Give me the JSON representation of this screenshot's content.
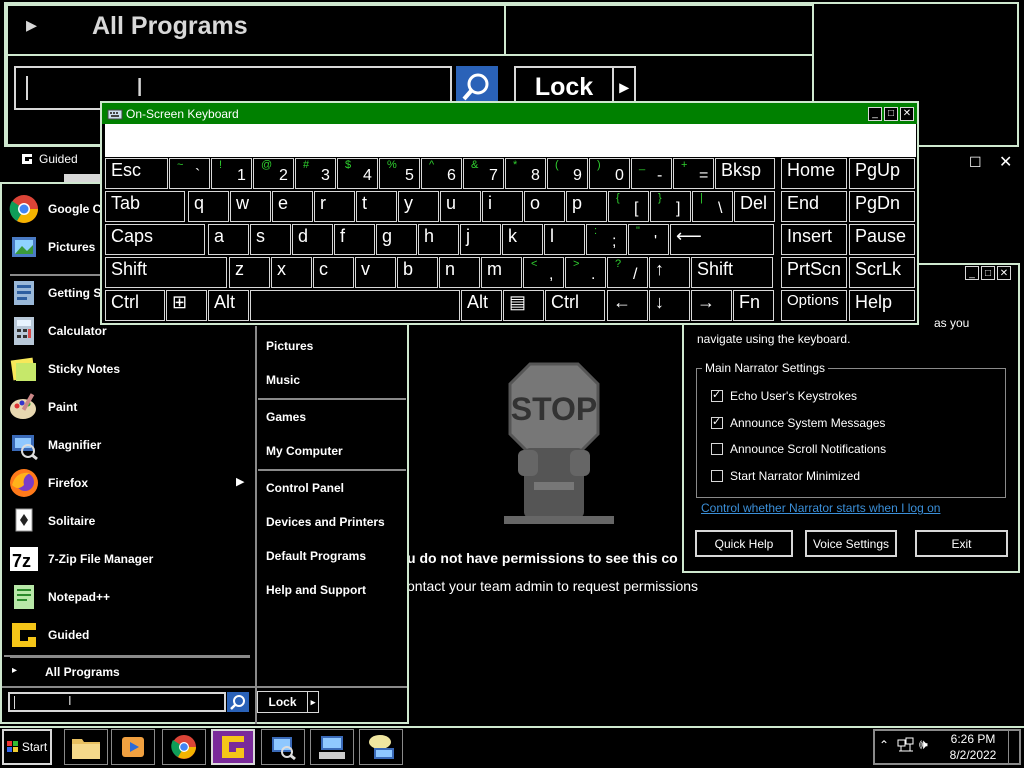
{
  "magnifier": {
    "all_programs": "All Programs",
    "lock": "Lock"
  },
  "guided": {
    "title": "Guided",
    "no_permission": "u do not have permissions to see this co",
    "contact_admin": "ontact your team admin to request permissions",
    "stop_sign": "STOP"
  },
  "keyboard": {
    "title": "On-Screen Keyboard",
    "rows": [
      [
        {
          "main": "Esc"
        },
        {
          "sub": "~",
          "base": "`"
        },
        {
          "sub": "!",
          "base": "1"
        },
        {
          "sub": "@",
          "base": "2"
        },
        {
          "sub": "#",
          "base": "3"
        },
        {
          "sub": "$",
          "base": "4"
        },
        {
          "sub": "%",
          "base": "5"
        },
        {
          "sub": "^",
          "base": "6"
        },
        {
          "sub": "&",
          "base": "7"
        },
        {
          "sub": "*",
          "base": "8"
        },
        {
          "sub": "(",
          "base": "9"
        },
        {
          "sub": ")",
          "base": "0"
        },
        {
          "sub": "_",
          "base": "-"
        },
        {
          "sub": "+",
          "base": "="
        },
        {
          "main": "Bksp"
        },
        {
          "main": "Home"
        },
        {
          "main": "PgUp"
        }
      ],
      [
        {
          "main": "Tab"
        },
        {
          "main": "q"
        },
        {
          "main": "w"
        },
        {
          "main": "e"
        },
        {
          "main": "r"
        },
        {
          "main": "t"
        },
        {
          "main": "y"
        },
        {
          "main": "u"
        },
        {
          "main": "i"
        },
        {
          "main": "o"
        },
        {
          "main": "p"
        },
        {
          "sub": "{",
          "base": "["
        },
        {
          "sub": "}",
          "base": "]"
        },
        {
          "sub": "|",
          "base": "\\"
        },
        {
          "main": "Del"
        },
        {
          "main": "End"
        },
        {
          "main": "PgDn"
        }
      ],
      [
        {
          "main": "Caps"
        },
        {
          "main": "a"
        },
        {
          "main": "s"
        },
        {
          "main": "d"
        },
        {
          "main": "f"
        },
        {
          "main": "g"
        },
        {
          "main": "h"
        },
        {
          "main": "j"
        },
        {
          "main": "k"
        },
        {
          "main": "l"
        },
        {
          "sub": ":",
          "base": ";"
        },
        {
          "sub": "\"",
          "base": "'"
        },
        {
          "main": "⟵"
        },
        {
          "main": "Insert"
        },
        {
          "main": "Pause"
        }
      ],
      [
        {
          "main": "Shift"
        },
        {
          "main": "z"
        },
        {
          "main": "x"
        },
        {
          "main": "c"
        },
        {
          "main": "v"
        },
        {
          "main": "b"
        },
        {
          "main": "n"
        },
        {
          "main": "m"
        },
        {
          "sub": "<",
          "base": ","
        },
        {
          "sub": ">",
          "base": "."
        },
        {
          "sub": "?",
          "base": "/"
        },
        {
          "main": "↑"
        },
        {
          "main": "Shift"
        },
        {
          "main": "PrtScn"
        },
        {
          "main": "ScrLk"
        }
      ],
      [
        {
          "main": "Ctrl"
        },
        {
          "main": "⊞"
        },
        {
          "main": "Alt"
        },
        {
          "main": ""
        },
        {
          "main": "Alt"
        },
        {
          "main": "▤"
        },
        {
          "main": "Ctrl"
        },
        {
          "main": "←"
        },
        {
          "main": "↓"
        },
        {
          "main": "→"
        },
        {
          "main": "Fn"
        },
        {
          "main": "Options"
        },
        {
          "main": "Help"
        }
      ]
    ]
  },
  "start_menu": {
    "programs": [
      {
        "label": "Google C",
        "icon": "chrome-icon"
      },
      {
        "label": "Pictures",
        "icon": "pictures-icon"
      },
      {
        "label": "Getting S",
        "icon": "getting-started-icon"
      },
      {
        "label": "Calculator",
        "icon": "calculator-icon"
      },
      {
        "label": "Sticky Notes",
        "icon": "sticky-notes-icon"
      },
      {
        "label": "Paint",
        "icon": "paint-icon"
      },
      {
        "label": "Magnifier",
        "icon": "magnifier-icon"
      },
      {
        "label": "Firefox",
        "icon": "firefox-icon"
      },
      {
        "label": "Solitaire",
        "icon": "solitaire-icon"
      },
      {
        "label": "7-Zip File Manager",
        "icon": "7zip-icon"
      },
      {
        "label": "Notepad++",
        "icon": "notepadpp-icon"
      },
      {
        "label": "Guided",
        "icon": "guided-icon"
      }
    ],
    "all_programs": "All Programs",
    "right_links": [
      "Pictures",
      "Music",
      "Games",
      "My Computer",
      "Control Panel",
      "Devices and Printers",
      "Default Programs",
      "Help and Support"
    ],
    "lock": "Lock"
  },
  "narrator": {
    "intro_tail": "as you",
    "intro_line2": "navigate using the keyboard.",
    "group_title": "Main Narrator Settings",
    "options": [
      {
        "label": "Echo User's Keystrokes",
        "checked": true
      },
      {
        "label": "Announce System Messages",
        "checked": true
      },
      {
        "label": "Announce Scroll Notifications",
        "checked": false
      },
      {
        "label": "Start Narrator Minimized",
        "checked": false
      }
    ],
    "link": "Control whether Narrator starts when I log on",
    "buttons": [
      "Quick Help",
      "Voice Settings",
      "Exit"
    ]
  },
  "taskbar": {
    "start": "Start",
    "time": "6:26 PM",
    "date": "8/2/2022"
  }
}
